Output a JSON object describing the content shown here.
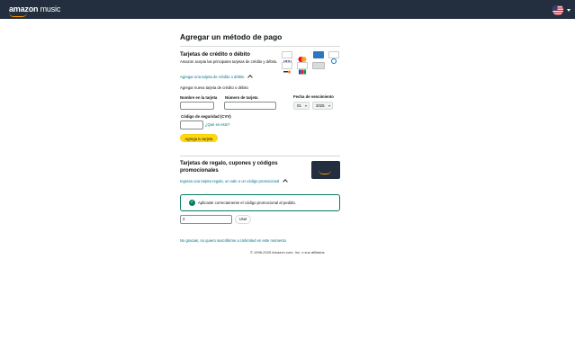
{
  "header": {
    "logo_brand": "amazon",
    "logo_product": " music",
    "flag_icon": "us-flag-icon",
    "brand_accent": "#ff9900"
  },
  "page_title": "Agregar un método de pago",
  "cards_section": {
    "title": "Tarjetas de crédito o débito",
    "description": "Amazon acepta las principales tarjetas de crédito y débito.",
    "toggle_link": "Agregar una tarjeta de crédito o débito",
    "new_card_heading": "Agregar nueva tarjeta de crédito o débito",
    "name_label": "Nombre en la tarjeta",
    "number_label": "Número de tarjeta",
    "expiry_label": "Fecha de vencimiento",
    "expiry_month": "01",
    "expiry_year": "2025",
    "cvv_label": "Código de seguridad (CVV)",
    "cvv_help": "¿Qué es esto?",
    "add_button": "Agrega tu tarjeta",
    "card_logos": [
      "visa-icon",
      "mastercard-icon",
      "amex-icon",
      "diners-icon",
      "discover-icon",
      "jcb-icon",
      "generic-card-icon"
    ]
  },
  "gift_section": {
    "title": "Tarjetas de regalo, cupones y códigos promocionales",
    "toggle_link": "Ingresa una tarjeta regalo, un vale o un código promocional",
    "success_message": "Aplicaste correctamente el código promocional al pedido.",
    "code_value": "2",
    "use_button": "Usar"
  },
  "decline_link": "No gracias, no quiero suscribirme a Unlimited en este momento",
  "footer": "© 1996-2025 Amazon.com, Inc. o sus afiliados"
}
